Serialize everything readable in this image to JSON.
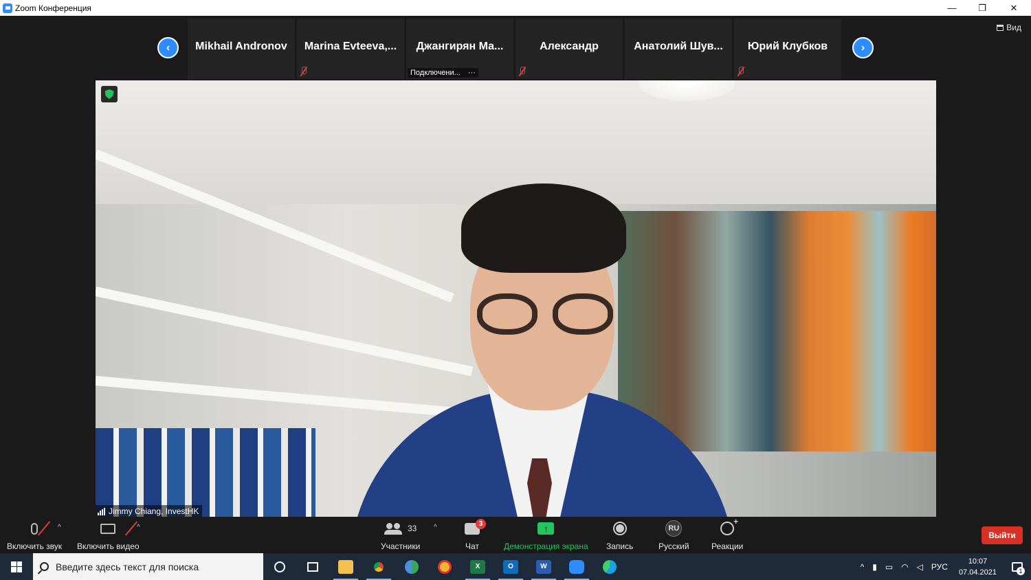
{
  "window": {
    "title": "Zoom Конференция",
    "minimize": "—",
    "restore": "❐",
    "close": "✕"
  },
  "view_button": "Вид",
  "participants_strip": [
    {
      "name": "Mikhail Andronov",
      "muted": false,
      "status": ""
    },
    {
      "name": "Marina Evteeva,...",
      "muted": true,
      "status": ""
    },
    {
      "name": "Джангирян Ма...",
      "muted": false,
      "status": "Подключени...",
      "status_more": "···"
    },
    {
      "name": "Александр",
      "muted": true,
      "status": ""
    },
    {
      "name": "Анатолий Шув...",
      "muted": false,
      "status": ""
    },
    {
      "name": "Юрий Клубков",
      "muted": true,
      "status": ""
    }
  ],
  "speaker": {
    "name": "Jimmy Chiang, InvestHK"
  },
  "toolbar": {
    "unmute_label": "Включить звук",
    "start_video_label": "Включить видео",
    "participants_label": "Участники",
    "participants_count": "33",
    "chat_label": "Чат",
    "chat_badge": "3",
    "share_label": "Демонстрация экрана",
    "record_label": "Запись",
    "language_label": "Русский",
    "language_code": "RU",
    "reactions_label": "Реакции",
    "leave_label": "Выйти",
    "colors": {
      "accent": "#2d8cff",
      "share": "#23c45e",
      "leave": "#d93025"
    }
  },
  "taskbar": {
    "search_placeholder": "Введите здесь текст для поиска",
    "language": "РУС",
    "time": "10:07",
    "date": "07.04.2021",
    "notifications": "1",
    "apps": [
      "cortana-icon",
      "task-view-icon",
      "file-explorer-icon",
      "chrome-icon",
      "maps-icon",
      "browser-icon",
      "excel-icon",
      "outlook-icon",
      "word-icon",
      "zoom-icon",
      "edge-icon"
    ]
  }
}
